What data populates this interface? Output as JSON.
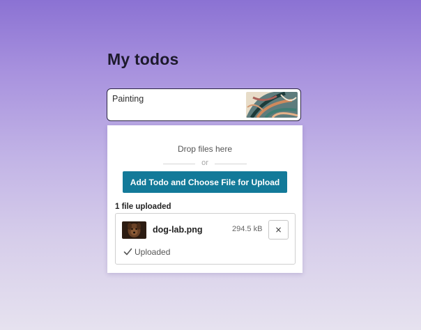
{
  "page": {
    "heading": "My todos"
  },
  "todo": {
    "text": "Painting",
    "thumbnail_icon": "painting-thumbnail-image"
  },
  "uploader": {
    "drop_text": "Drop files here",
    "or_text": "or",
    "button_label": "Add Todo and Choose File for Upload",
    "uploaded_count_text": "1 file uploaded",
    "file": {
      "name": "dog-lab.png",
      "size": "294.5 kB",
      "thumbnail_icon": "dog-photo-thumbnail-image",
      "remove_symbol": "×",
      "remove_icon": "close-icon",
      "status_icon": "check-icon",
      "status": "Uploaded"
    }
  },
  "colors": {
    "accent_button": "#137a99",
    "background_top": "#8b72d3",
    "background_bottom": "#e6e2ef"
  }
}
